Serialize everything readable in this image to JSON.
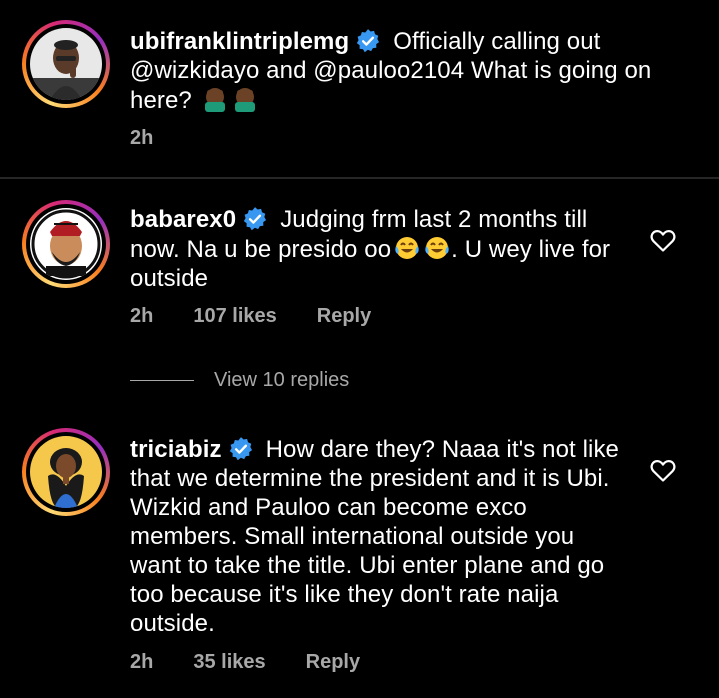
{
  "comments": [
    {
      "username": "ubifranklintriplemg",
      "text": "Officially calling out @wizkidayo and @pauloo2104 What is going on here?",
      "time": "2h"
    },
    {
      "username": "babarex0",
      "text": "Judging frm last 2 months till now. Na u be presido oo",
      "text_after_emoji": ". U wey live for outside",
      "time": "2h",
      "likes": "107 likes",
      "reply": "Reply"
    },
    {
      "username": "triciabiz",
      "text": "How dare they? Naaa it's not like that we determine the president and it is Ubi. Wizkid and Pauloo can become exco members. Small international outside you want to take the title. Ubi enter plane and go too because it's like they don't rate naija outside.",
      "time": "2h",
      "likes": "35 likes",
      "reply": "Reply"
    }
  ],
  "view_replies": "View 10 replies",
  "colors": {
    "background": "#000000",
    "text": "#ffffff",
    "muted": "#a8a8a8",
    "verified": "#3897f0",
    "divider": "#262626"
  },
  "icons": {
    "verified": "verified-badge-icon",
    "heart": "heart-outline-icon",
    "emoji_facepalm": "facepalm-emoji-icon",
    "emoji_laugh": "tears-of-joy-emoji-icon"
  }
}
